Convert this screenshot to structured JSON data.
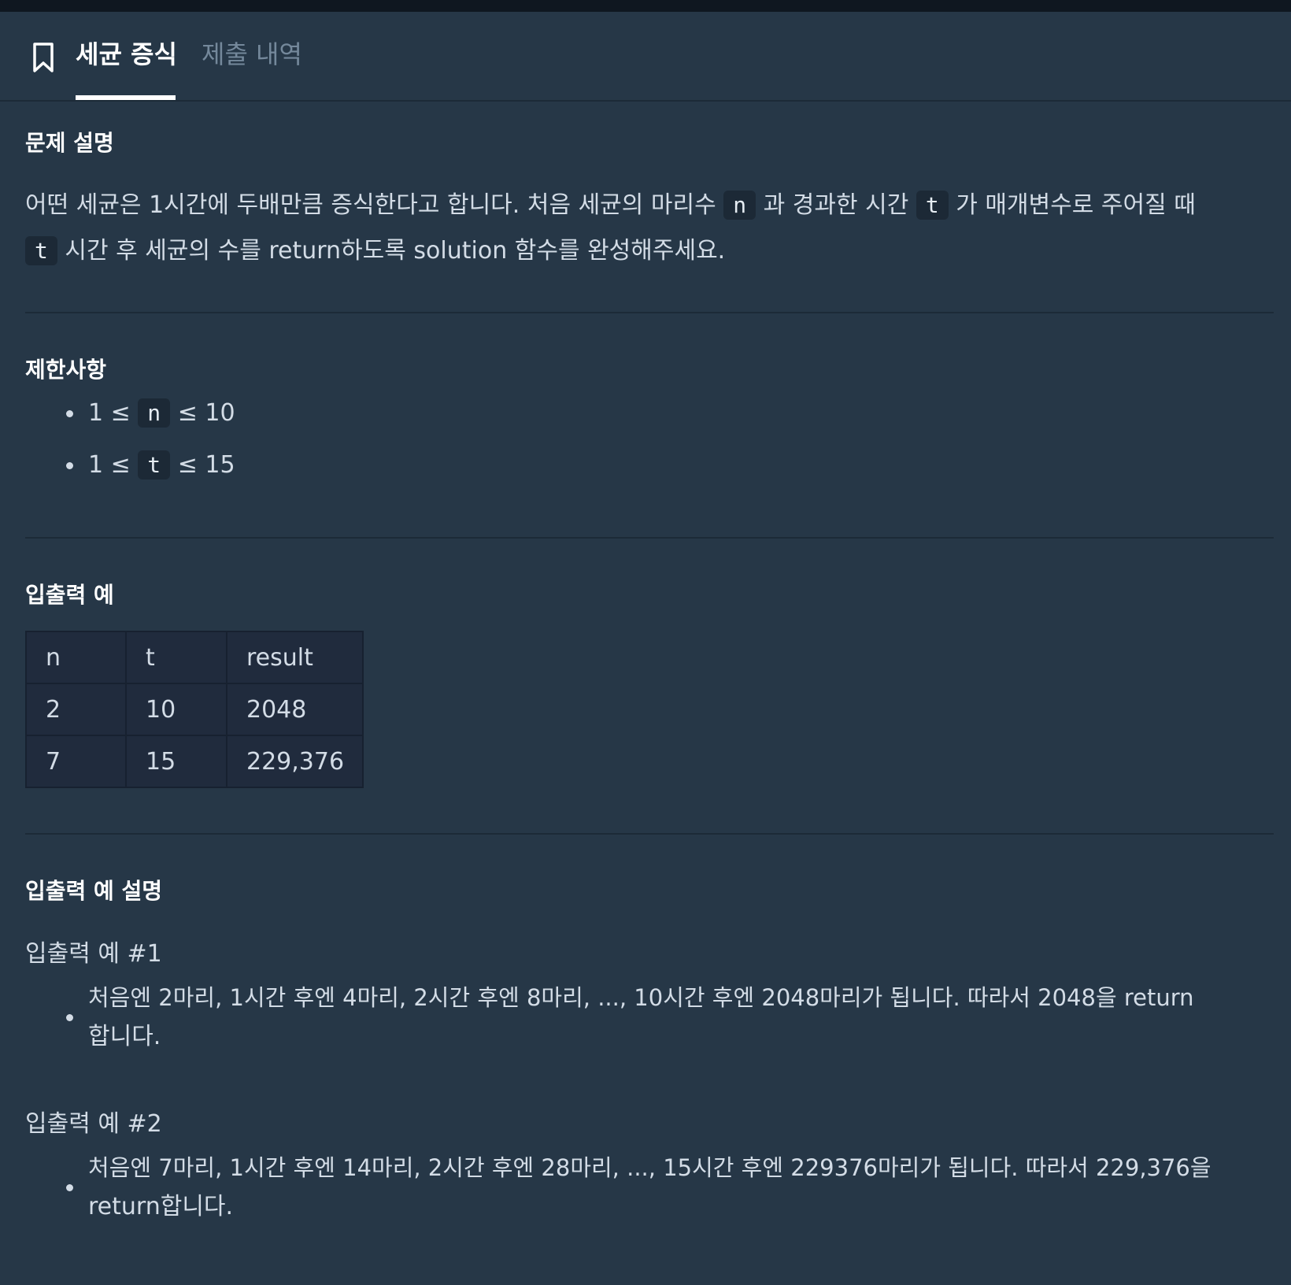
{
  "tabs": {
    "active": "세균 증식",
    "inactive": "제출 내역"
  },
  "sections": {
    "description": {
      "title": "문제 설명",
      "line1_a": "어떤 세균은 1시간에 두배만큼 증식한다고 합니다. 처음 세균의 마리수 ",
      "code_n": "n",
      "line1_b": " 과 경과한 시간 ",
      "code_t": "t",
      "line1_c": " 가 매개변수로 주어질 때",
      "line2_code": "t",
      "line2_b": " 시간 후 세균의 수를 return하도록 solution 함수를 완성해주세요."
    },
    "constraints": {
      "title": "제한사항",
      "items": [
        {
          "prefix": "1 ≤ ",
          "code": "n",
          "suffix": " ≤ 10"
        },
        {
          "prefix": "1 ≤ ",
          "code": "t",
          "suffix": " ≤ 15"
        }
      ]
    },
    "examples": {
      "title": "입출력 예",
      "headers": [
        "n",
        "t",
        "result"
      ],
      "rows": [
        [
          "2",
          "10",
          "2048"
        ],
        [
          "7",
          "15",
          "229,376"
        ]
      ]
    },
    "explanation": {
      "title": "입출력 예 설명",
      "ex1_title": "입출력 예 #1",
      "ex1_line1": "처음엔 2마리, 1시간 후엔 4마리, 2시간 후엔 8마리, ..., 10시간 후엔 2048마리가 됩니다. 따라서 2048을 return",
      "ex1_line2": "합니다.",
      "ex2_title": "입출력 예 #2",
      "ex2_line1": "처음엔 7마리, 1시간 후엔 14마리, 2시간 후엔 28마리, ..., 15시간 후엔 229376마리가 됩니다. 따라서 229,376을",
      "ex2_line2": "return합니다."
    }
  }
}
